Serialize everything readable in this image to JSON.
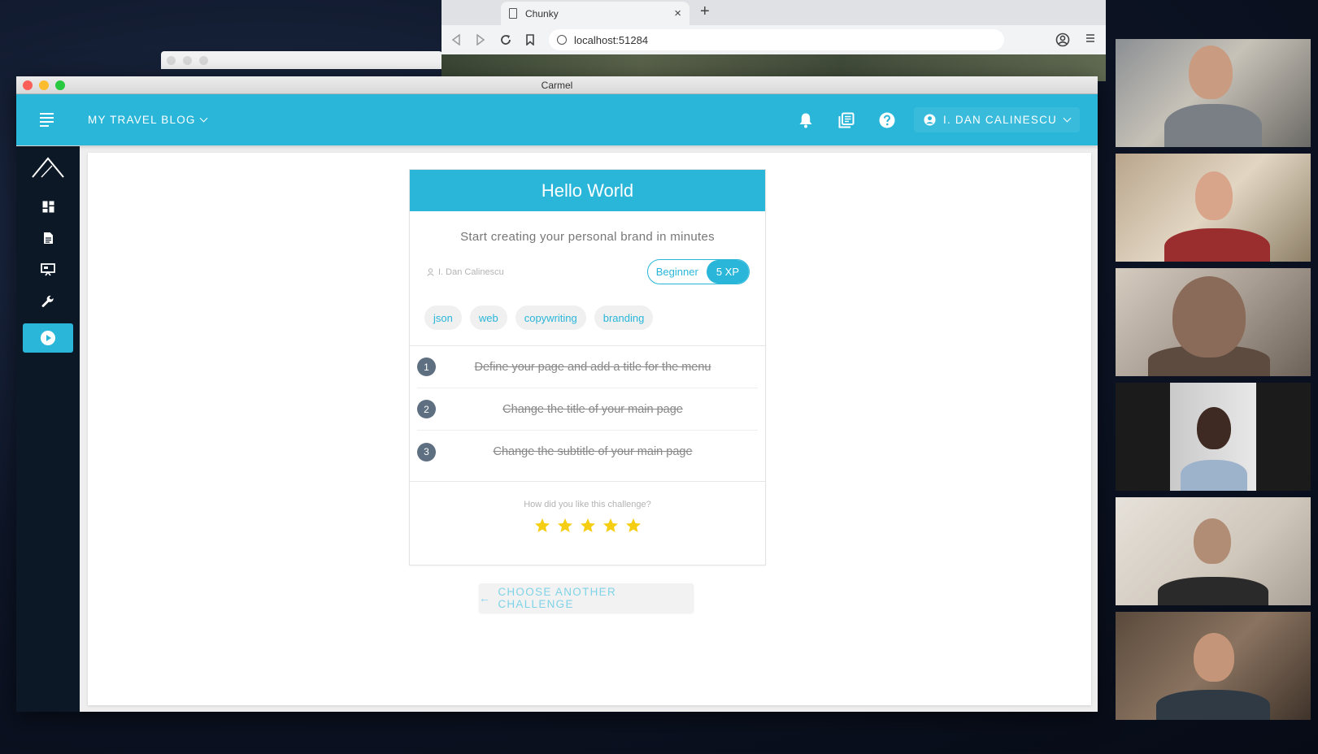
{
  "browser": {
    "tab_title": "Chunky",
    "tab_close": "×",
    "new_tab": "+",
    "url": "localhost:51284"
  },
  "window": {
    "title": "Carmel"
  },
  "appbar": {
    "blog_name": "MY TRAVEL BLOG",
    "user_name": "I. DAN CALINESCU",
    "icons": [
      "menu-icon",
      "bell-icon",
      "library-icon",
      "help-icon",
      "account-icon"
    ]
  },
  "sidebar": {
    "items": [
      "dashboard-icon",
      "document-icon",
      "presentation-icon",
      "wrench-icon",
      "play-icon"
    ],
    "active_index": 4
  },
  "challenge": {
    "title": "Hello World",
    "subtitle": "Start creating your personal brand in minutes",
    "author": "I. Dan Calinescu",
    "level": "Beginner",
    "xp": "5 XP",
    "tags": [
      "json",
      "web",
      "copywriting",
      "branding"
    ],
    "steps": [
      {
        "number": "1",
        "text": "Define your page and add a title for the menu",
        "done": true
      },
      {
        "number": "2",
        "text": "Change the title of your main page",
        "done": true
      },
      {
        "number": "3",
        "text": "Change the subtitle of your main page",
        "done": true
      }
    ],
    "rating_question": "How did you like this challenge?",
    "rating": 5,
    "rating_max": 5,
    "another_button": "CHOOSE ANOTHER CHALLENGE",
    "another_arrow": "←"
  },
  "colors": {
    "accent": "#29b6d9",
    "sidebar": "#0d1827",
    "star": "#f5cd12",
    "step_badge": "#5d6f80"
  },
  "video_call": {
    "participant_count": 6
  }
}
